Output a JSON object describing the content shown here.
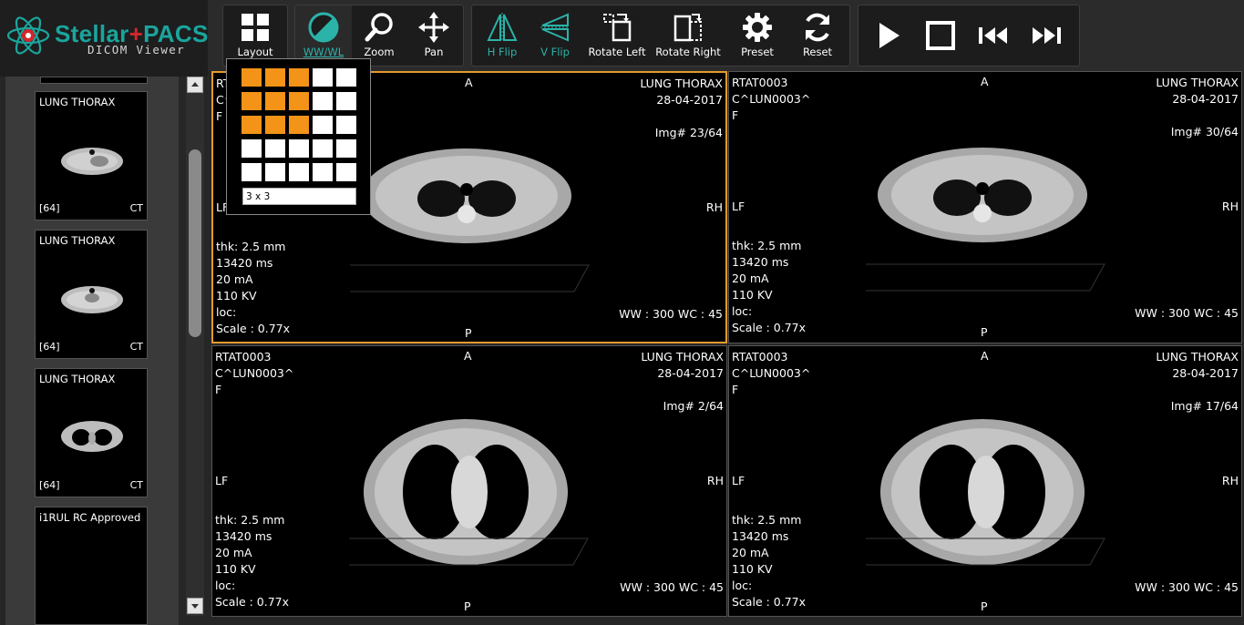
{
  "app": {
    "brand_name": "Stellar",
    "brand_plus": "+",
    "brand_product": "PACS",
    "brand_sub": "DICOM Viewer",
    "accent": "#1aa59d",
    "highlight": "#e59a2e"
  },
  "toolbar": {
    "layout": "Layout",
    "wwwl": "WW/WL",
    "zoom": "Zoom",
    "pan": "Pan",
    "hflip": "H Flip",
    "vflip": "V Flip",
    "rotate_left": "Rotate Left",
    "rotate_right": "Rotate Right",
    "preset": "Preset",
    "reset": "Reset"
  },
  "thumbnails": [
    {
      "title": "LUNG THORAX",
      "count": "[64]",
      "modality": "CT"
    },
    {
      "title": "LUNG THORAX",
      "count": "[64]",
      "modality": "CT"
    },
    {
      "title": "LUNG THORAX",
      "count": "[64]",
      "modality": "CT"
    },
    {
      "title": "i1RUL RC Approved",
      "count": "",
      "modality": ""
    }
  ],
  "layout_popup": {
    "rows": 5,
    "cols": 5,
    "selected_rows": 3,
    "selected_cols": 3,
    "value": "3 x 3"
  },
  "viewports": [
    {
      "patient_id": "RTAT0003",
      "patient_name": "C^LUN0003^",
      "sex": "F",
      "study": "LUNG THORAX",
      "date": "28-04-2017",
      "img": "Img# 23/64",
      "top": "A",
      "bottom": "P",
      "left": "LF",
      "right": "RH",
      "thk": "thk: 2.5 mm",
      "time": "13420 ms",
      "ma": "20 mA",
      "kv": "110 KV",
      "loc": "loc:",
      "scale": "Scale : 0.77x",
      "wwwc": "WW : 300 WC : 45"
    },
    {
      "patient_id": "RTAT0003",
      "patient_name": "C^LUN0003^",
      "sex": "F",
      "study": "LUNG THORAX",
      "date": "28-04-2017",
      "img": "Img# 30/64",
      "top": "A",
      "bottom": "P",
      "left": "LF",
      "right": "RH",
      "thk": "thk: 2.5 mm",
      "time": "13420 ms",
      "ma": "20 mA",
      "kv": "110 KV",
      "loc": "loc:",
      "scale": "Scale : 0.77x",
      "wwwc": "WW : 300 WC : 45"
    },
    {
      "patient_id": "RTAT0003",
      "patient_name": "C^LUN0003^",
      "sex": "F",
      "study": "LUNG THORAX",
      "date": "28-04-2017",
      "img": "Img# 2/64",
      "top": "A",
      "bottom": "P",
      "left": "LF",
      "right": "RH",
      "thk": "thk: 2.5 mm",
      "time": "13420 ms",
      "ma": "20 mA",
      "kv": "110 KV",
      "loc": "loc:",
      "scale": "Scale : 0.77x",
      "wwwc": "WW : 300 WC : 45"
    },
    {
      "patient_id": "RTAT0003",
      "patient_name": "C^LUN0003^",
      "sex": "F",
      "study": "LUNG THORAX",
      "date": "28-04-2017",
      "img": "Img# 17/64",
      "top": "A",
      "bottom": "P",
      "left": "LF",
      "right": "RH",
      "thk": "thk: 2.5 mm",
      "time": "13420 ms",
      "ma": "20 mA",
      "kv": "110 KV",
      "loc": "loc:",
      "scale": "Scale : 0.77x",
      "wwwc": "WW : 300 WC : 45"
    }
  ]
}
